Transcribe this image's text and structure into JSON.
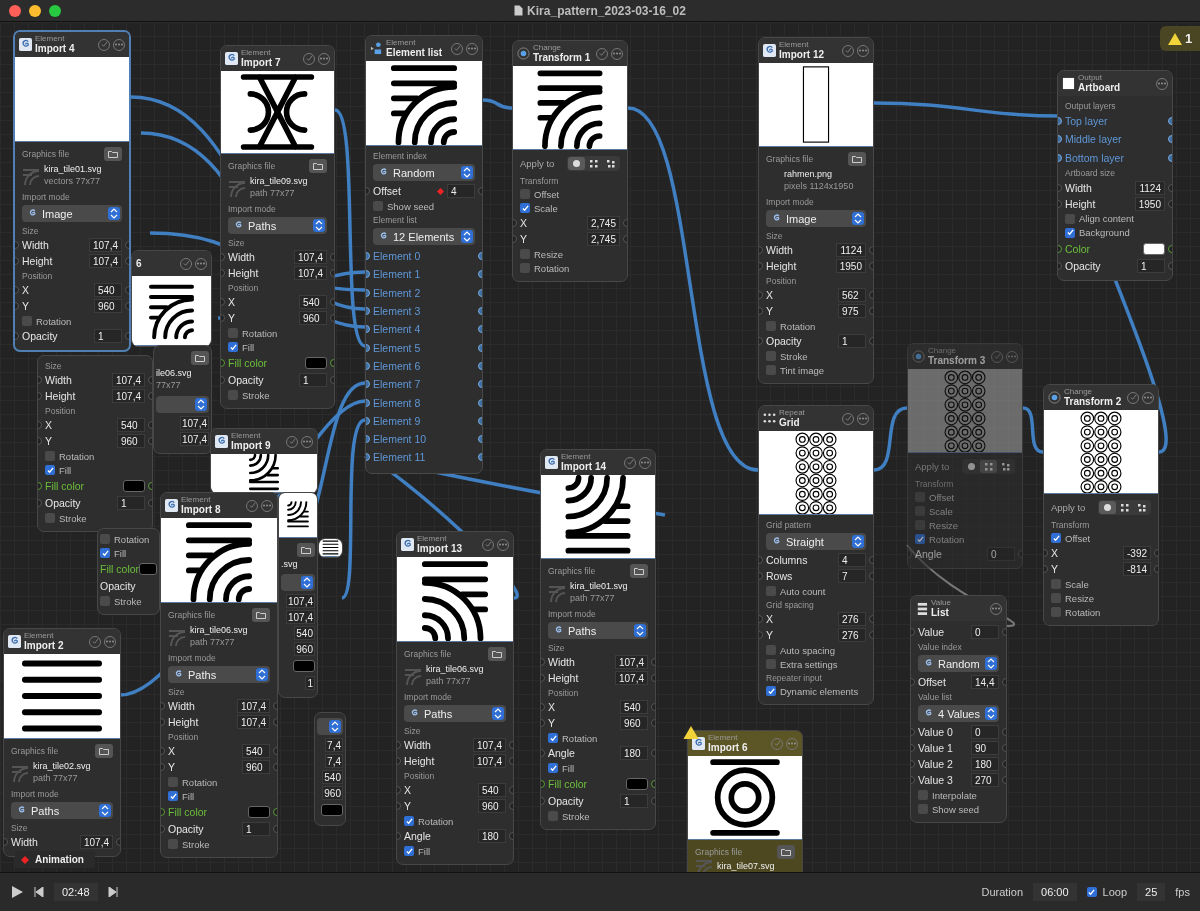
{
  "window": {
    "title": "Kira_pattern_2023-03-16_02"
  },
  "warning_badge": {
    "count": "1"
  },
  "partly_hidden_nodes": [
    {
      "title": "6",
      "toggle": true,
      "preview": {
        "kind": "arcs"
      }
    },
    {
      "rows": [
        {
          "kind": "file-header"
        },
        {
          "kind": "file",
          "name": "ile06.svg",
          "meta": "77x77"
        },
        {
          "kind": "select"
        },
        {
          "kind": "field",
          "value": "107,4"
        },
        {
          "kind": "field",
          "value": "107,4"
        }
      ]
    },
    {
      "rows": [
        {
          "kind": "caption",
          "text": "Size"
        },
        {
          "kind": "field",
          "label": "Width",
          "value": "107,4"
        },
        {
          "kind": "field",
          "label": "Height",
          "value": "107,4"
        },
        {
          "kind": "caption",
          "text": "Position"
        },
        {
          "kind": "field",
          "label": "X",
          "value": "540"
        },
        {
          "kind": "field",
          "label": "Y",
          "value": "960"
        },
        {
          "kind": "check",
          "label": "Rotation",
          "checked": false
        },
        {
          "kind": "check",
          "label": "Fill",
          "checked": true
        },
        {
          "kind": "color",
          "label": "Fill color",
          "color": "#000000"
        },
        {
          "kind": "field",
          "label": "Opacity",
          "value": "1"
        },
        {
          "kind": "check",
          "label": "Stroke",
          "checked": false
        }
      ]
    },
    {
      "kind": "element",
      "category": "Element",
      "title": "Import 9",
      "toggle": true,
      "preview": {
        "kind": "arcs-down"
      }
    },
    {
      "preview": {
        "kind": "arcs-down"
      },
      "rows": [
        {
          "kind": "file-header"
        },
        {
          "kind": "file",
          "name": ".svg"
        },
        {
          "kind": "select"
        },
        {
          "kind": "field",
          "value": "107,4"
        },
        {
          "kind": "field",
          "value": "107,4"
        },
        {
          "kind": "field",
          "value": "540"
        },
        {
          "kind": "field",
          "value": "960"
        },
        {
          "kind": "color",
          "color": "#000000"
        },
        {
          "kind": "field",
          "value": "1"
        }
      ]
    },
    {
      "rows": [
        {
          "kind": "check",
          "label": "Rotation",
          "checked": false
        },
        {
          "kind": "check",
          "label": "Fill",
          "checked": true
        },
        {
          "kind": "color",
          "label": "Fill color",
          "color": "#000000"
        },
        {
          "kind": "field",
          "label": "Opacity"
        },
        {
          "kind": "check",
          "label": "Stroke",
          "checked": false
        }
      ]
    },
    {
      "preview": {
        "kind": "lines"
      }
    },
    {
      "rows": [
        {
          "kind": "select"
        },
        {
          "kind": "field",
          "value": "7,4"
        },
        {
          "kind": "field",
          "value": "7,4"
        },
        {
          "kind": "field",
          "value": "540"
        },
        {
          "kind": "field",
          "value": "960"
        },
        {
          "kind": "color",
          "color": "#000000"
        }
      ]
    }
  ],
  "nodes": [
    {
      "kind": "element",
      "category": "Element",
      "title": "Import 4",
      "selected": true,
      "warning": false,
      "disabled": false,
      "toggle": true,
      "preview": {
        "kind": "blank"
      },
      "rows": [
        {
          "kind": "file-header",
          "text": "Graphics file"
        },
        {
          "kind": "file",
          "name": "kira_tile01.svg",
          "meta": "vectors 77x77",
          "thumbnail": true
        },
        {
          "kind": "caption",
          "text": "Import mode"
        },
        {
          "kind": "select",
          "text": "Image"
        },
        {
          "kind": "caption",
          "text": "Size"
        },
        {
          "kind": "field",
          "label": "Width",
          "value": "107,4"
        },
        {
          "kind": "field",
          "label": "Height",
          "value": "107,4"
        },
        {
          "kind": "caption",
          "text": "Position"
        },
        {
          "kind": "field",
          "label": "X",
          "value": "540"
        },
        {
          "kind": "field",
          "label": "Y",
          "value": "960"
        },
        {
          "kind": "check",
          "label": "Rotation",
          "checked": false
        },
        {
          "kind": "field",
          "label": "Opacity",
          "value": "1"
        }
      ]
    },
    {
      "kind": "element",
      "category": "Element",
      "title": "Import 7",
      "selected": false,
      "warning": false,
      "disabled": false,
      "toggle": true,
      "preview": {
        "kind": "hourglass"
      },
      "rows": [
        {
          "kind": "file-header",
          "text": "Graphics file"
        },
        {
          "kind": "file",
          "name": "kira_tile09.svg",
          "meta": "path 77x77",
          "thumbnail": true
        },
        {
          "kind": "caption",
          "text": "Import mode"
        },
        {
          "kind": "select",
          "text": "Paths"
        },
        {
          "kind": "caption",
          "text": "Size"
        },
        {
          "kind": "field",
          "label": "Width",
          "value": "107,4"
        },
        {
          "kind": "field",
          "label": "Height",
          "value": "107,4"
        },
        {
          "kind": "caption",
          "text": "Position"
        },
        {
          "kind": "field",
          "label": "X",
          "value": "540"
        },
        {
          "kind": "field",
          "label": "Y",
          "value": "960"
        },
        {
          "kind": "check",
          "label": "Rotation",
          "checked": false
        },
        {
          "kind": "check",
          "label": "Fill",
          "checked": true
        },
        {
          "kind": "color",
          "label": "Fill color",
          "color": "#000000"
        },
        {
          "kind": "field",
          "label": "Opacity",
          "value": "1"
        },
        {
          "kind": "check",
          "label": "Stroke",
          "checked": false
        }
      ]
    },
    {
      "kind": "list",
      "category": "Element",
      "title": "Element list",
      "selected": false,
      "warning": false,
      "disabled": false,
      "toggle": true,
      "preview": {
        "kind": "arcs"
      },
      "rows": [
        {
          "kind": "caption",
          "text": "Element index"
        },
        {
          "kind": "select",
          "text": "Random"
        },
        {
          "kind": "field",
          "label": "Offset",
          "value": "4",
          "animated": true
        },
        {
          "kind": "check",
          "label": "Show seed",
          "checked": false
        },
        {
          "kind": "caption",
          "text": "Element list"
        },
        {
          "kind": "select",
          "text": "12 Elements"
        },
        {
          "kind": "port",
          "label": "Element 0"
        },
        {
          "kind": "port",
          "label": "Element 1"
        },
        {
          "kind": "port",
          "label": "Element 2"
        },
        {
          "kind": "port",
          "label": "Element 3"
        },
        {
          "kind": "port",
          "label": "Element 4"
        },
        {
          "kind": "port",
          "label": "Element 5"
        },
        {
          "kind": "port",
          "label": "Element 6"
        },
        {
          "kind": "port",
          "label": "Element 7"
        },
        {
          "kind": "port",
          "label": "Element 8"
        },
        {
          "kind": "port",
          "label": "Element 9"
        },
        {
          "kind": "port",
          "label": "Element 10"
        },
        {
          "kind": "port",
          "label": "Element 11"
        }
      ]
    },
    {
      "kind": "change",
      "category": "Change",
      "title": "Transform 1",
      "selected": false,
      "warning": false,
      "disabled": false,
      "toggle": true,
      "preview": {
        "kind": "arcs"
      },
      "rows": [
        {
          "kind": "apply",
          "label": "Apply to",
          "segments": [
            {
              "selected": true
            },
            {
              "selected": false
            },
            {
              "selected": false
            }
          ]
        },
        {
          "kind": "caption",
          "text": "Transform"
        },
        {
          "kind": "check",
          "label": "Offset",
          "checked": false
        },
        {
          "kind": "check",
          "label": "Scale",
          "checked": true
        },
        {
          "kind": "field",
          "label": "X",
          "value": "2,745"
        },
        {
          "kind": "field",
          "label": "Y",
          "value": "2,745"
        },
        {
          "kind": "check",
          "label": "Resize",
          "checked": false
        },
        {
          "kind": "check",
          "label": "Rotation",
          "checked": false
        }
      ]
    },
    {
      "kind": "element",
      "category": "Element",
      "title": "Import 12",
      "selected": false,
      "warning": false,
      "disabled": false,
      "toggle": true,
      "preview": {
        "kind": "frame"
      },
      "rows": [
        {
          "kind": "file-header",
          "text": "Graphics file"
        },
        {
          "kind": "file",
          "name": "rahmen.png",
          "meta": "pixels 1124x1950",
          "thumbnail": false
        },
        {
          "kind": "caption",
          "text": "Import mode"
        },
        {
          "kind": "select",
          "text": "Image"
        },
        {
          "kind": "caption",
          "text": "Size"
        },
        {
          "kind": "field",
          "label": "Width",
          "value": "1124"
        },
        {
          "kind": "field",
          "label": "Height",
          "value": "1950"
        },
        {
          "kind": "caption",
          "text": "Position"
        },
        {
          "kind": "field",
          "label": "X",
          "value": "562"
        },
        {
          "kind": "field",
          "label": "Y",
          "value": "975"
        },
        {
          "kind": "check",
          "label": "Rotation",
          "checked": false
        },
        {
          "kind": "field",
          "label": "Opacity",
          "value": "1"
        },
        {
          "kind": "check",
          "label": "Stroke",
          "checked": false
        },
        {
          "kind": "check",
          "label": "Tint image",
          "checked": false
        }
      ]
    },
    {
      "kind": "output",
      "category": "Output",
      "title": "Artboard",
      "selected": false,
      "warning": false,
      "disabled": false,
      "toggle": false,
      "rows": [
        {
          "kind": "caption",
          "text": "Output layers"
        },
        {
          "kind": "port",
          "label": "Top layer"
        },
        {
          "kind": "port",
          "label": "Middle layer"
        },
        {
          "kind": "port",
          "label": "Bottom layer"
        },
        {
          "kind": "caption",
          "text": "Artboard size"
        },
        {
          "kind": "field",
          "label": "Width",
          "value": "1124"
        },
        {
          "kind": "field",
          "label": "Height",
          "value": "1950"
        },
        {
          "kind": "check",
          "label": "Align content",
          "checked": false
        },
        {
          "kind": "check",
          "label": "Background",
          "checked": true
        },
        {
          "kind": "color",
          "label": "Color",
          "color": "#ffffff"
        },
        {
          "kind": "field",
          "label": "Opacity",
          "value": "1"
        }
      ]
    },
    {
      "kind": "repeat",
      "category": "Repeat",
      "title": "Grid",
      "selected": false,
      "warning": false,
      "disabled": false,
      "toggle": true,
      "preview": {
        "kind": "pattern"
      },
      "rows": [
        {
          "kind": "caption",
          "text": "Grid pattern"
        },
        {
          "kind": "select",
          "text": "Straight"
        },
        {
          "kind": "field",
          "label": "Columns",
          "value": "4"
        },
        {
          "kind": "field",
          "label": "Rows",
          "value": "7"
        },
        {
          "kind": "check",
          "label": "Auto count",
          "checked": false
        },
        {
          "kind": "caption",
          "text": "Grid spacing"
        },
        {
          "kind": "field",
          "label": "X",
          "value": "276"
        },
        {
          "kind": "field",
          "label": "Y",
          "value": "276"
        },
        {
          "kind": "check",
          "label": "Auto spacing",
          "checked": false
        },
        {
          "kind": "check",
          "label": "Extra settings",
          "checked": false
        },
        {
          "kind": "caption",
          "text": "Repeater input"
        },
        {
          "kind": "check",
          "label": "Dynamic elements",
          "checked": true
        }
      ]
    },
    {
      "kind": "change",
      "category": "Change",
      "title": "Transform 3",
      "selected": false,
      "warning": false,
      "disabled": true,
      "toggle": true,
      "preview": {
        "kind": "pattern"
      },
      "rows": [
        {
          "kind": "apply",
          "label": "Apply to",
          "segments": [
            {
              "selected": false
            },
            {
              "selected": true
            },
            {
              "selected": false
            }
          ]
        },
        {
          "kind": "caption",
          "text": "Transform"
        },
        {
          "kind": "check",
          "label": "Offset",
          "checked": false
        },
        {
          "kind": "check",
          "label": "Scale",
          "checked": false
        },
        {
          "kind": "check",
          "label": "Resize",
          "checked": false
        },
        {
          "kind": "check",
          "label": "Rotation",
          "checked": true
        },
        {
          "kind": "field",
          "label": "Angle",
          "value": "0"
        }
      ]
    },
    {
      "kind": "change",
      "category": "Change",
      "title": "Transform 2",
      "selected": false,
      "warning": false,
      "disabled": false,
      "toggle": true,
      "preview": {
        "kind": "pattern"
      },
      "rows": [
        {
          "kind": "apply",
          "label": "Apply to",
          "segments": [
            {
              "selected": true
            },
            {
              "selected": false
            },
            {
              "selected": false
            }
          ]
        },
        {
          "kind": "caption",
          "text": "Transform"
        },
        {
          "kind": "check",
          "label": "Offset",
          "checked": true
        },
        {
          "kind": "field",
          "label": "X",
          "value": "-392"
        },
        {
          "kind": "field",
          "label": "Y",
          "value": "-814"
        },
        {
          "kind": "check",
          "label": "Scale",
          "checked": false
        },
        {
          "kind": "check",
          "label": "Resize",
          "checked": false
        },
        {
          "kind": "check",
          "label": "Rotation",
          "checked": false
        }
      ]
    },
    {
      "kind": "value",
      "category": "Value",
      "title": "List",
      "selected": false,
      "warning": false,
      "disabled": false,
      "toggle": false,
      "rows": [
        {
          "kind": "field",
          "label": "Value",
          "value": "0"
        },
        {
          "kind": "caption",
          "text": "Value index"
        },
        {
          "kind": "select",
          "text": "Random"
        },
        {
          "kind": "field",
          "label": "Offset",
          "value": "14,4"
        },
        {
          "kind": "caption",
          "text": "Value list"
        },
        {
          "kind": "select",
          "text": "4 Values"
        },
        {
          "kind": "field",
          "label": "Value 0",
          "value": "0"
        },
        {
          "kind": "field",
          "label": "Value 1",
          "value": "90"
        },
        {
          "kind": "field",
          "label": "Value 2",
          "value": "180"
        },
        {
          "kind": "field",
          "label": "Value 3",
          "value": "270"
        },
        {
          "kind": "check",
          "label": "Interpolate",
          "checked": false
        },
        {
          "kind": "check",
          "label": "Show seed",
          "checked": false
        }
      ]
    },
    {
      "kind": "element",
      "category": "Element",
      "title": "Import 14",
      "selected": false,
      "warning": false,
      "disabled": false,
      "toggle": true,
      "preview": {
        "kind": "arcs-down"
      },
      "rows": [
        {
          "kind": "file-header",
          "text": "Graphics file"
        },
        {
          "kind": "file",
          "name": "kira_tile01.svg",
          "meta": "path 77x77",
          "thumbnail": true
        },
        {
          "kind": "caption",
          "text": "Import mode"
        },
        {
          "kind": "select",
          "text": "Paths"
        },
        {
          "kind": "caption",
          "text": "Size"
        },
        {
          "kind": "field",
          "label": "Width",
          "value": "107,4"
        },
        {
          "kind": "field",
          "label": "Height",
          "value": "107,4"
        },
        {
          "kind": "caption",
          "text": "Position"
        },
        {
          "kind": "field",
          "label": "X",
          "value": "540"
        },
        {
          "kind": "field",
          "label": "Y",
          "value": "960"
        },
        {
          "kind": "check",
          "label": "Rotation",
          "checked": true
        },
        {
          "kind": "field",
          "label": "Angle",
          "value": "180"
        },
        {
          "kind": "check",
          "label": "Fill",
          "checked": true
        },
        {
          "kind": "color",
          "label": "Fill color",
          "color": "#000000"
        },
        {
          "kind": "field",
          "label": "Opacity",
          "value": "1"
        },
        {
          "kind": "check",
          "label": "Stroke",
          "checked": false
        }
      ]
    },
    {
      "kind": "element",
      "category": "Element",
      "title": "Import 13",
      "selected": false,
      "warning": false,
      "disabled": false,
      "toggle": true,
      "preview": {
        "kind": "arcs-up"
      },
      "rows": [
        {
          "kind": "file-header",
          "text": "Graphics file"
        },
        {
          "kind": "file",
          "name": "kira_tile06.svg",
          "meta": "path 77x77",
          "thumbnail": true
        },
        {
          "kind": "caption",
          "text": "Import mode"
        },
        {
          "kind": "select",
          "text": "Paths"
        },
        {
          "kind": "caption",
          "text": "Size"
        },
        {
          "kind": "field",
          "label": "Width",
          "value": "107,4"
        },
        {
          "kind": "field",
          "label": "Height",
          "value": "107,4"
        },
        {
          "kind": "caption",
          "text": "Position"
        },
        {
          "kind": "field",
          "label": "X",
          "value": "540"
        },
        {
          "kind": "field",
          "label": "Y",
          "value": "960"
        },
        {
          "kind": "check",
          "label": "Rotation",
          "checked": true
        },
        {
          "kind": "field",
          "label": "Angle",
          "value": "180"
        },
        {
          "kind": "check",
          "label": "Fill",
          "checked": true
        }
      ]
    },
    {
      "kind": "element",
      "category": "Element",
      "title": "Import 6",
      "selected": false,
      "warning": true,
      "disabled": false,
      "toggle": true,
      "preview": {
        "kind": "rings"
      },
      "rows": [
        {
          "kind": "file-header",
          "text": "Graphics file"
        },
        {
          "kind": "file",
          "name": "kira_tile07.svg",
          "thumbnail": true
        }
      ]
    },
    {
      "kind": "element",
      "category": "Element",
      "title": "Import 2",
      "selected": false,
      "warning": false,
      "disabled": false,
      "toggle": true,
      "preview": {
        "kind": "lines"
      },
      "rows": [
        {
          "kind": "file-header",
          "text": "Graphics file"
        },
        {
          "kind": "file",
          "name": "kira_tile02.svg",
          "meta": "path 77x77",
          "thumbnail": true
        },
        {
          "kind": "caption",
          "text": "Import mode"
        },
        {
          "kind": "select",
          "text": "Paths"
        },
        {
          "kind": "caption",
          "text": "Size"
        },
        {
          "kind": "field",
          "label": "Width",
          "value": "107,4"
        }
      ]
    },
    {
      "kind": "element",
      "category": "Element",
      "title": "Import 8",
      "selected": false,
      "warning": false,
      "disabled": false,
      "toggle": true,
      "preview": {
        "kind": "arcs"
      },
      "rows": [
        {
          "kind": "file-header",
          "text": "Graphics file"
        },
        {
          "kind": "file",
          "name": "kira_tile06.svg",
          "meta": "path 77x77",
          "thumbnail": true
        },
        {
          "kind": "caption",
          "text": "Import mode"
        },
        {
          "kind": "select",
          "text": "Paths"
        },
        {
          "kind": "caption",
          "text": "Size"
        },
        {
          "kind": "field",
          "label": "Width",
          "value": "107,4"
        },
        {
          "kind": "field",
          "label": "Height",
          "value": "107,4"
        },
        {
          "kind": "caption",
          "text": "Position"
        },
        {
          "kind": "field",
          "label": "X",
          "value": "540"
        },
        {
          "kind": "field",
          "label": "Y",
          "value": "960"
        },
        {
          "kind": "check",
          "label": "Rotation",
          "checked": false
        },
        {
          "kind": "check",
          "label": "Fill",
          "checked": true
        },
        {
          "kind": "color",
          "label": "Fill color",
          "color": "#000000"
        },
        {
          "kind": "field",
          "label": "Opacity",
          "value": "1"
        },
        {
          "kind": "check",
          "label": "Stroke",
          "checked": false
        }
      ]
    }
  ],
  "animation_button": {
    "label": "Animation"
  },
  "playback": {
    "time": "02:48",
    "duration_label": "Duration",
    "duration": "06:00",
    "loop": {
      "label": "Loop",
      "checked": true
    },
    "fps": "25",
    "fps_label": "fps"
  }
}
